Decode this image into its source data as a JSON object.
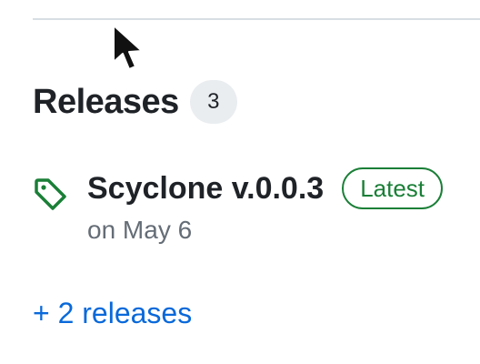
{
  "releases": {
    "title": "Releases",
    "count": "3",
    "latest": {
      "name": "Scyclone v.0.0.3",
      "badge": "Latest",
      "date": "on May 6",
      "icon": "tag-icon"
    },
    "more_link": "+ 2 releases"
  },
  "colors": {
    "accent_link": "#0969da",
    "latest_green": "#1a7f37",
    "muted_text": "#656d76"
  }
}
